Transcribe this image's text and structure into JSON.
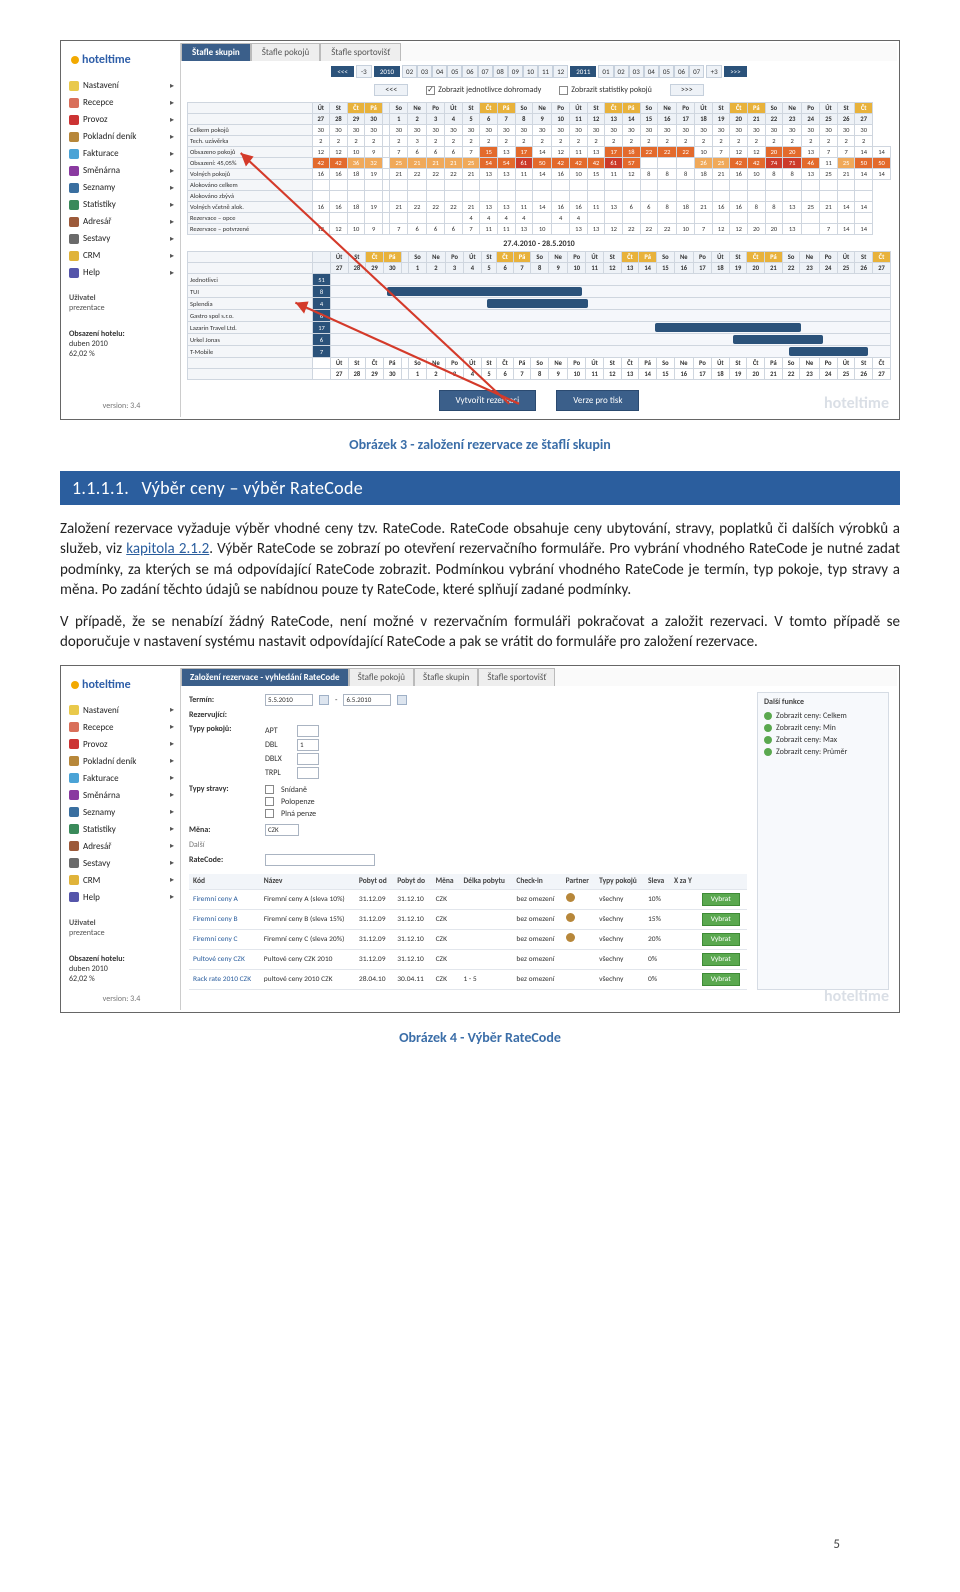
{
  "pagenum": "5",
  "logo_alt": "sun-clock-icon",
  "appshot1": {
    "brand": "hoteltime",
    "nav": [
      {
        "label": "Nastavení",
        "color": "#e9c94b"
      },
      {
        "label": "Recepce",
        "color": "#d96f5a"
      },
      {
        "label": "Provoz",
        "color": "#c33"
      },
      {
        "label": "Pokladní deník",
        "color": "#b7873a"
      },
      {
        "label": "Fakturace",
        "color": "#4aa3d6"
      },
      {
        "label": "Směnárna",
        "color": "#8a3aa0"
      },
      {
        "label": "Seznamy",
        "color": "#3a6fa0"
      },
      {
        "label": "Statistiky",
        "color": "#3a8a5a"
      },
      {
        "label": "Adresář",
        "color": "#9c5a3a"
      },
      {
        "label": "Sestavy",
        "color": "#6a6a6a"
      },
      {
        "label": "CRM",
        "color": "#e0b33a"
      },
      {
        "label": "Help",
        "color": "#55a"
      }
    ],
    "user": {
      "title": "Uživatel",
      "sub": "prezentace"
    },
    "occupancy": {
      "title": "Obsazení hotelu:",
      "period": "duben 2010",
      "value": "62,02 %"
    },
    "version": "version: 3.4",
    "tabs": [
      "Štafle skupin",
      "Štafle pokojů",
      "Štafle sportovišť"
    ],
    "active_tab": 0,
    "datebar": {
      "left_arrow": "<<<",
      "left_off": "-3",
      "yearA": "2010",
      "yearB": "2011",
      "cellsA": [
        "02",
        "03",
        "04",
        "05",
        "06",
        "07",
        "08",
        "09",
        "10",
        "11",
        "12"
      ],
      "cellsB": [
        "01",
        "02",
        "03",
        "04",
        "05",
        "06",
        "07"
      ],
      "right_off": "+3",
      "right_arrow": ">>>"
    },
    "optbar": {
      "left": "<<<",
      "opt1": "Zobrazit jednotlivce dohromady",
      "opt2": "Zobrazit statistiky pokojů",
      "right": ">>>"
    },
    "day_header_top": [
      "Út",
      "St",
      "Čt",
      "Pá",
      "",
      "So",
      "Ne",
      "Po",
      "Út",
      "St",
      "Čt",
      "Pá",
      "So",
      "Ne",
      "Po",
      "Út",
      "St",
      "Čt",
      "Pá",
      "So",
      "Ne",
      "Po",
      "Út",
      "St",
      "Čt",
      "Pá",
      "So",
      "Ne",
      "Po",
      "Út",
      "St",
      "Čt"
    ],
    "day_header_num": [
      "27",
      "28",
      "29",
      "30",
      "",
      "1",
      "2",
      "3",
      "4",
      "5",
      "6",
      "7",
      "8",
      "9",
      "10",
      "11",
      "12",
      "13",
      "14",
      "15",
      "16",
      "17",
      "18",
      "19",
      "20",
      "21",
      "22",
      "23",
      "24",
      "25",
      "26",
      "27"
    ],
    "rows_top": [
      {
        "label": "Celkem pokojů",
        "cells": [
          "30",
          "30",
          "30",
          "30",
          "",
          "30",
          "30",
          "30",
          "30",
          "30",
          "30",
          "30",
          "30",
          "30",
          "30",
          "30",
          "30",
          "30",
          "30",
          "30",
          "30",
          "30",
          "30",
          "30",
          "30",
          "30",
          "30",
          "30",
          "30",
          "30",
          "30",
          "30"
        ]
      },
      {
        "label": "Tech. uzávěrka",
        "cells": [
          "2",
          "2",
          "2",
          "2",
          "",
          "2",
          "3",
          "2",
          "2",
          "2",
          "2",
          "2",
          "2",
          "2",
          "2",
          "2",
          "2",
          "2",
          "2",
          "2",
          "2",
          "2",
          "2",
          "2",
          "2",
          "2",
          "2",
          "2",
          "2",
          "2",
          "2",
          "2"
        ]
      },
      {
        "label": "Obsazeno pokojů",
        "cells": [
          "12",
          "12",
          "10",
          "9",
          "",
          "7",
          "6",
          "6",
          "6",
          "7",
          "15",
          "13",
          "17",
          "14",
          "12",
          "11",
          "13",
          "17",
          "18",
          "22",
          "22",
          "22",
          "10",
          "7",
          "12",
          "12",
          "20",
          "20",
          "13",
          "7",
          "7",
          "14",
          "14"
        ],
        "style": "red"
      },
      {
        "label": "Obsazení:     45,05%",
        "cells": [
          "42",
          "42",
          "36",
          "32",
          "",
          "25",
          "21",
          "21",
          "21",
          "25",
          "54",
          "54",
          "61",
          "50",
          "42",
          "42",
          "42",
          "61",
          "57",
          "",
          "",
          "",
          "26",
          "25",
          "42",
          "42",
          "74",
          "71",
          "46",
          "11",
          "25",
          "50",
          "50"
        ],
        "style": "hot"
      },
      {
        "label": "Volných pokojů",
        "cells": [
          "16",
          "16",
          "18",
          "19",
          "",
          "21",
          "22",
          "22",
          "22",
          "21",
          "13",
          "13",
          "11",
          "14",
          "16",
          "10",
          "15",
          "11",
          "12",
          "8",
          "8",
          "8",
          "18",
          "21",
          "16",
          "10",
          "8",
          "8",
          "13",
          "25",
          "21",
          "14",
          "14"
        ]
      },
      {
        "label": "Alokováno celkem",
        "cells": [
          "",
          "",
          "",
          "",
          "",
          "",
          "",
          "",
          "",
          "",
          "",
          "",
          "",
          "",
          "",
          "",
          "",
          "",
          "",
          "",
          "",
          "",
          "",
          "",
          "",
          "",
          "",
          "",
          "",
          "",
          "",
          ""
        ]
      },
      {
        "label": "Alokováno zbývá",
        "cells": [
          "",
          "",
          "",
          "",
          "",
          "",
          "",
          "",
          "",
          "",
          "",
          "",
          "",
          "",
          "",
          "",
          "",
          "",
          "",
          "",
          "",
          "",
          "",
          "",
          "",
          "",
          "",
          "",
          "",
          "",
          "",
          ""
        ]
      },
      {
        "label": "Volných včetně alok.",
        "cells": [
          "16",
          "16",
          "18",
          "19",
          "",
          "21",
          "22",
          "22",
          "22",
          "21",
          "13",
          "13",
          "11",
          "14",
          "16",
          "16",
          "11",
          "13",
          "6",
          "6",
          "8",
          "18",
          "21",
          "16",
          "16",
          "8",
          "8",
          "13",
          "25",
          "21",
          "14",
          "14"
        ]
      },
      {
        "label": "Rezervace – opce",
        "cells": [
          "",
          "",
          "",
          "",
          "",
          "",
          "",
          "",
          "",
          "4",
          "4",
          "4",
          "4",
          "",
          "4",
          "4",
          "",
          "",
          "",
          "",
          "",
          "",
          "",
          "",
          "",
          "",
          "",
          "",
          "",
          "",
          "",
          ""
        ]
      },
      {
        "label": "Rezervace – potvrzené",
        "cells": [
          "12",
          "12",
          "10",
          "9",
          "",
          "7",
          "6",
          "6",
          "6",
          "7",
          "11",
          "11",
          "13",
          "10",
          "",
          "13",
          "13",
          "12",
          "22",
          "22",
          "22",
          "10",
          "7",
          "12",
          "12",
          "20",
          "20",
          "13",
          "",
          "7",
          "14",
          "14"
        ]
      }
    ],
    "daterange": "27.4.2010 - 28.5.2010",
    "rows_bars": [
      {
        "label": "Jednotlivci",
        "val": "51",
        "segs": []
      },
      {
        "label": "TUI",
        "val": "8",
        "segs": [
          {
            "l": 10,
            "w": 35
          }
        ]
      },
      {
        "label": "Splendia",
        "val": "4",
        "segs": [
          {
            "l": 28,
            "w": 18
          }
        ]
      },
      {
        "label": "Gastro spol s.r.o.",
        "val": "6",
        "segs": []
      },
      {
        "label": "Lazarin Travel Ltd.",
        "val": "17",
        "segs": [
          {
            "l": 58,
            "w": 26
          }
        ]
      },
      {
        "label": "Urkel Jonas",
        "val": "6",
        "segs": [
          {
            "l": 72,
            "w": 16
          }
        ]
      },
      {
        "label": "T-Mobile",
        "val": "7",
        "segs": [
          {
            "l": 82,
            "w": 14
          }
        ]
      }
    ],
    "buttons": [
      "Vytvořit rezervaci",
      "Verze pro tisk"
    ],
    "watermark": "hoteltime"
  },
  "caption1": "Obrázek 3 - založení rezervace ze štaflí skupin",
  "heading": {
    "num": "1.1.1.1.",
    "text": "Výběr ceny – výběr RateCode"
  },
  "para1_a": "Založení rezervace vyžaduje výběr vhodné ceny tzv. RateCode. RateCode obsahuje ceny ubytování, stravy, poplatků či dalších výrobků a služeb, viz ",
  "para1_link": "kapitola 2.1.2",
  "para1_b": ". Výběr RateCode se zobrazí po otevření rezervačního formuláře. Pro vybrání vhodného RateCode je nutné zadat podmínky, za kterých se má odpovídající RateCode zobrazit. Podmínkou vybrání vhodného RateCode je termín, typ pokoje, typ stravy a měna. Po zadání těchto údajů se nabídnou pouze ty RateCode, které splňují zadané podmínky.",
  "para2": "V případě, že se nenabízí žádný RateCode, není možné v rezervačním formuláři pokračovat a založit rezervaci. V tomto případě se doporučuje v nastavení systému nastavit odpovídající RateCode a pak se vrátit do formuláře pro založení rezervace.",
  "appshot2": {
    "brand": "hoteltime",
    "nav_same": true,
    "tabs": [
      "Založení rezervace - vyhledání RateCode",
      "Štafle pokojů",
      "Štafle skupin",
      "Štafle sportovišť"
    ],
    "form": {
      "termin_label": "Termín:",
      "termin_from": "5.5.2010",
      "termin_to": "6.5.2010",
      "rezervujici_label": "Rezervující:",
      "typy_pokoju_label": "Typy pokojů:",
      "room_types": [
        {
          "code": "APT",
          "val": ""
        },
        {
          "code": "DBL",
          "val": "1"
        },
        {
          "code": "DBLX",
          "val": ""
        },
        {
          "code": "TRPL",
          "val": ""
        }
      ],
      "typy_stravy_label": "Typy stravy:",
      "meal_types": [
        "Snídaně",
        "Polopenze",
        "Plná penze"
      ],
      "mena_label": "Měna:",
      "mena_val": "CZK",
      "dalsi_label": "Další",
      "ratecode_label": "RateCode:"
    },
    "side_fns": {
      "title": "Další funkce",
      "items": [
        "Zobrazit ceny: Celkem",
        "Zobrazit ceny: Min",
        "Zobrazit ceny: Max",
        "Zobrazit ceny: Průměr"
      ]
    },
    "table": {
      "headers": [
        "Kód",
        "Název",
        "Pobyt od",
        "Pobyt do",
        "Měna",
        "Délka pobytu",
        "Check-in",
        "Partner",
        "Typy pokojů",
        "Sleva",
        "X za Y",
        ""
      ],
      "rows": [
        {
          "kod": "Firemní ceny A",
          "nazev": "Firemní ceny A (sleva 10%)",
          "od": "31.12.09",
          "do": "31.12.10",
          "mena": "CZK",
          "delka": "",
          "checkin": "bez omezení",
          "partner": true,
          "typy": "všechny",
          "sleva": "10%",
          "xzay": "",
          "btn": "Vybrat"
        },
        {
          "kod": "Firemní ceny B",
          "nazev": "Firemní ceny B (sleva 15%)",
          "od": "31.12.09",
          "do": "31.12.10",
          "mena": "CZK",
          "delka": "",
          "checkin": "bez omezení",
          "partner": true,
          "typy": "všechny",
          "sleva": "15%",
          "xzay": "",
          "btn": "Vybrat"
        },
        {
          "kod": "Firemní ceny C",
          "nazev": "Firemní ceny C (sleva 20%)",
          "od": "31.12.09",
          "do": "31.12.10",
          "mena": "CZK",
          "delka": "",
          "checkin": "bez omezení",
          "partner": true,
          "typy": "všechny",
          "sleva": "20%",
          "xzay": "",
          "btn": "Vybrat"
        },
        {
          "kod": "Pultové ceny CZK",
          "nazev": "Pultové ceny CZK 2010",
          "od": "31.12.09",
          "do": "31.12.10",
          "mena": "CZK",
          "delka": "",
          "checkin": "bez omezení",
          "partner": false,
          "typy": "všechny",
          "sleva": "0%",
          "xzay": "",
          "btn": "Vybrat"
        },
        {
          "kod": "Rack rate 2010 CZK",
          "nazev": "pultové ceny 2010 CZK",
          "od": "28.04.10",
          "do": "30.04.11",
          "mena": "CZK",
          "delka": "1 - 5",
          "checkin": "bez omezení",
          "partner": false,
          "typy": "všechny",
          "sleva": "0%",
          "xzay": "",
          "btn": "Vybrat"
        }
      ]
    },
    "watermark": "hoteltime"
  },
  "caption2": "Obrázek 4 - Výběr RateCode"
}
